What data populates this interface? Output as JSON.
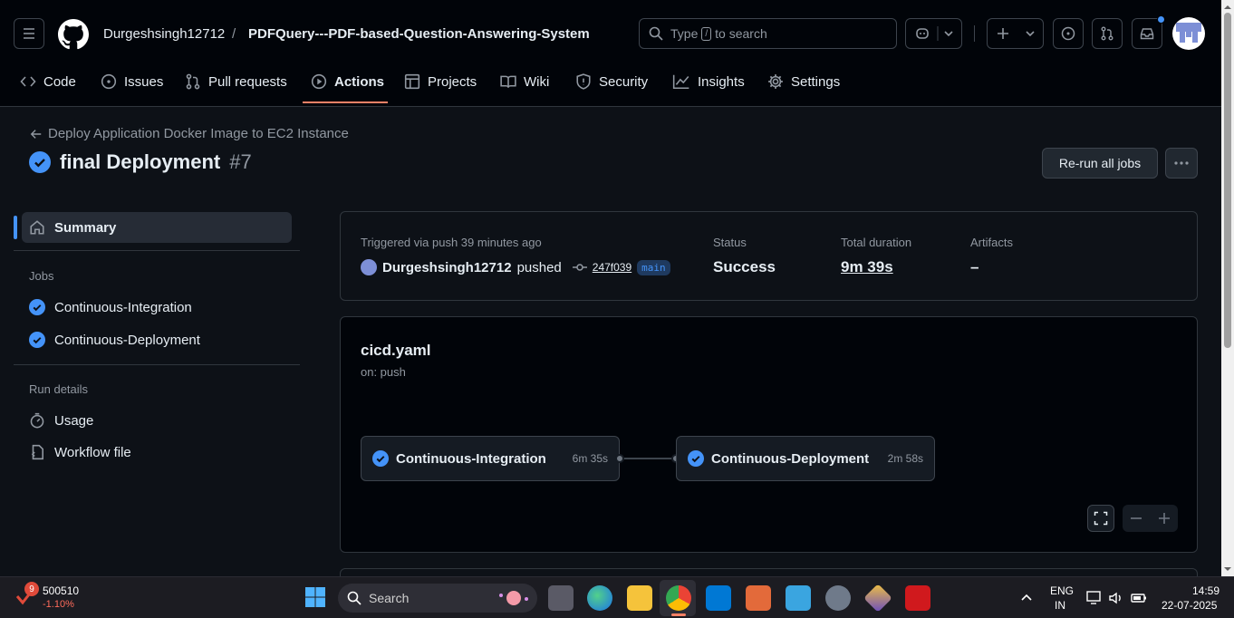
{
  "header": {
    "owner": "Durgeshsingh12712",
    "separator": "/",
    "repo": "PDFQuery---PDF-based-Question-Answering-System",
    "search_prefix": "Type",
    "search_key": "/",
    "search_suffix": "to search"
  },
  "tabs": [
    {
      "label": "Code",
      "icon": "code-icon"
    },
    {
      "label": "Issues",
      "icon": "issue-icon"
    },
    {
      "label": "Pull requests",
      "icon": "pull-request-icon"
    },
    {
      "label": "Actions",
      "icon": "play-icon",
      "active": true
    },
    {
      "label": "Projects",
      "icon": "table-icon"
    },
    {
      "label": "Wiki",
      "icon": "book-icon"
    },
    {
      "label": "Security",
      "icon": "shield-icon"
    },
    {
      "label": "Insights",
      "icon": "graph-icon"
    },
    {
      "label": "Settings",
      "icon": "gear-icon"
    }
  ],
  "run": {
    "workflow_name": "Deploy Application Docker Image to EC2 Instance",
    "title": "final Deployment",
    "number": "#7",
    "rerun_label": "Re-run all jobs"
  },
  "sidebar": {
    "summary": "Summary",
    "jobs_heading": "Jobs",
    "jobs": [
      "Continuous-Integration",
      "Continuous-Deployment"
    ],
    "run_details_heading": "Run details",
    "usage": "Usage",
    "workflow_file": "Workflow file"
  },
  "summary": {
    "triggered": "Triggered via push 39 minutes ago",
    "actor": "Durgeshsingh12712",
    "action": "pushed",
    "commit": "247f039",
    "branch": "main",
    "status_label": "Status",
    "status_value": "Success",
    "duration_label": "Total duration",
    "duration_value": "9m 39s",
    "artifacts_label": "Artifacts",
    "artifacts_value": "–"
  },
  "graph": {
    "file": "cicd.yaml",
    "trigger": "on: push",
    "jobs": [
      {
        "name": "Continuous-Integration",
        "duration": "6m 35s"
      },
      {
        "name": "Continuous-Deployment",
        "duration": "2m 58s"
      }
    ]
  },
  "taskbar": {
    "stock_badge": "9",
    "stock_name": "500510",
    "stock_change": "-1.10%",
    "search_label": "Search",
    "lang_top": "ENG",
    "lang_bottom": "IN",
    "time": "14:59",
    "date": "22-07-2025"
  },
  "colors": {
    "accent": "#f78166",
    "success": "#4493f8",
    "background": "#0d1117"
  }
}
